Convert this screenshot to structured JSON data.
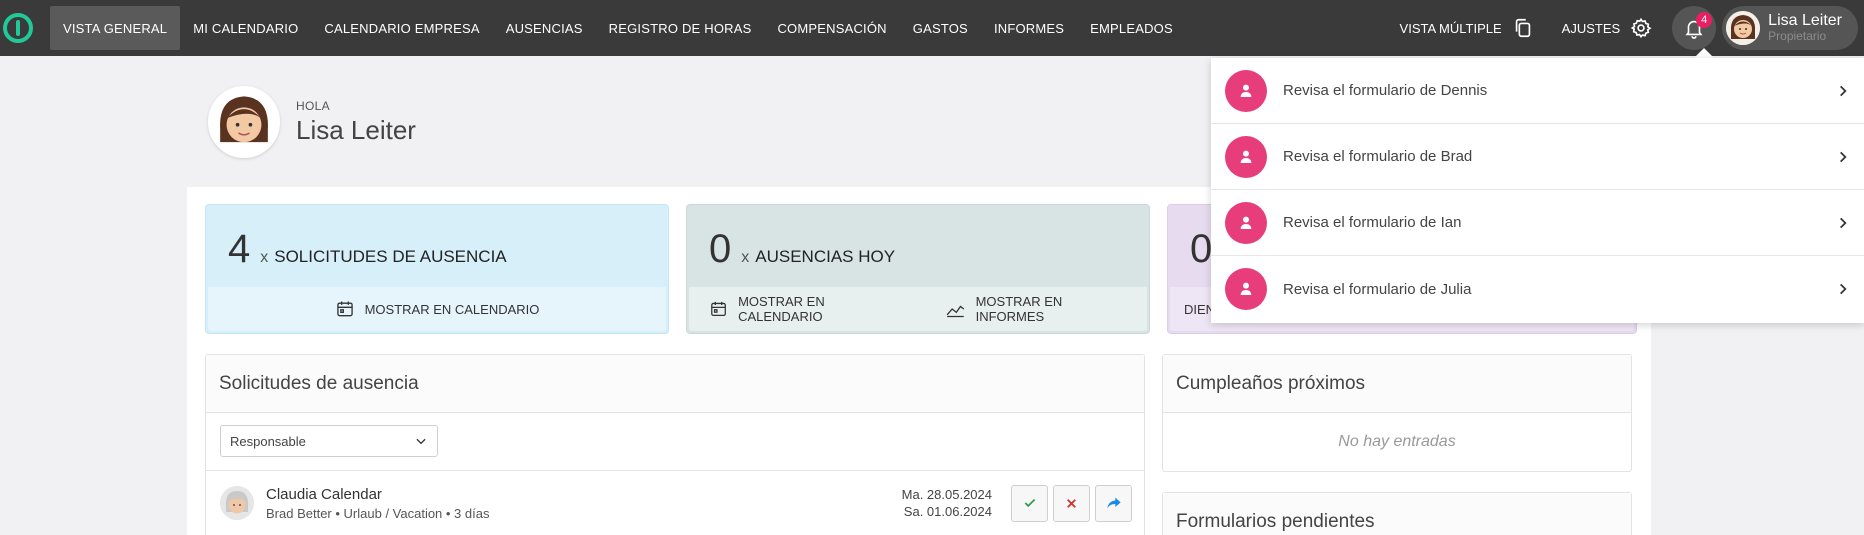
{
  "nav": {
    "items": [
      {
        "label": "VISTA GENERAL",
        "active": true
      },
      {
        "label": "MI CALENDARIO"
      },
      {
        "label": "CALENDARIO EMPRESA"
      },
      {
        "label": "AUSENCIAS"
      },
      {
        "label": "REGISTRO DE HORAS"
      },
      {
        "label": "COMPENSACIÓN"
      },
      {
        "label": "GASTOS"
      },
      {
        "label": "INFORMES"
      },
      {
        "label": "EMPLEADOS"
      }
    ],
    "multi_view": "VISTA MÚLTIPLE",
    "settings": "AJUSTES",
    "notification_count": "4",
    "user_name": "Lisa Leiter",
    "user_role": "Propietario"
  },
  "greeting": {
    "hello": "HOLA",
    "name": "Lisa Leiter"
  },
  "stats": {
    "requests": {
      "count": "4",
      "x": "x",
      "label": "SOLICITUDES DE AUSENCIA",
      "link": "MOSTRAR EN CALENDARIO"
    },
    "today": {
      "count": "0",
      "x": "x",
      "label": "AUSENCIAS HOY",
      "link_calendar": "MOSTRAR EN CALENDARIO",
      "link_reports": "MOSTRAR EN INFORMES"
    },
    "third": {
      "count": "0",
      "link": "DIEN"
    }
  },
  "absence_requests": {
    "title": "Solicitudes de ausencia",
    "filter": "Responsable",
    "rows": [
      {
        "name": "Claudia Calendar",
        "meta": "Brad Better • Urlaub / Vacation • 3 días",
        "date_from": "Ma. 28.05.2024",
        "date_to": "Sa. 01.06.2024"
      }
    ]
  },
  "birthdays": {
    "title": "Cumpleaños próximos",
    "empty": "No hay entradas"
  },
  "pending_forms": {
    "title": "Formularios pendientes"
  },
  "notifications": [
    {
      "text": "Revisa el formulario de Dennis"
    },
    {
      "text": "Revisa el formulario de Brad"
    },
    {
      "text": "Revisa el formulario de Ian"
    },
    {
      "text": "Revisa el formulario de Julia"
    }
  ],
  "colors": {
    "accent": "#20c997",
    "notification": "#e73d7b",
    "badge": "#e91e63",
    "topbar": "#3a3a3a"
  }
}
